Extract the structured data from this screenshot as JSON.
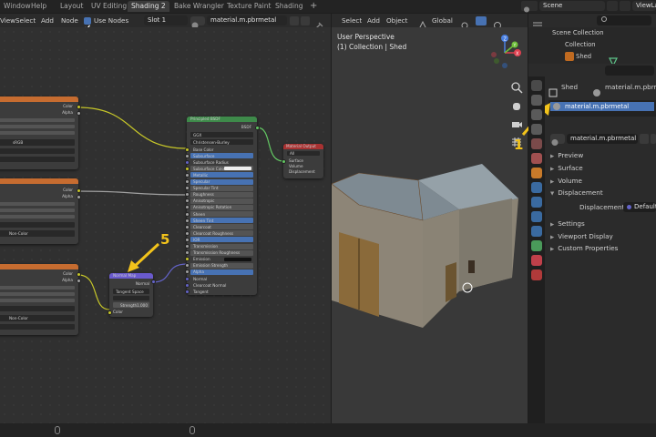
{
  "topbar": {
    "menus": [
      "Window",
      "Help"
    ],
    "tabs": [
      "Layout",
      "UV Editing",
      "Shading 2",
      "Bake Wrangler",
      "Texture Paint",
      "Shading"
    ],
    "add_tab": "+",
    "scene": "Scene",
    "view_layer": "ViewLayer"
  },
  "node_header": {
    "menus": [
      "View",
      "Select",
      "Add",
      "Node"
    ],
    "use_nodes": "Use Nodes",
    "slot": "Slot 1",
    "material": "material.m.pbrmetal"
  },
  "viewport_header": {
    "menus": [
      "Select",
      "Add",
      "Object"
    ],
    "transform": "Global"
  },
  "viewport": {
    "title": "User Perspective",
    "subtitle": "(1) Collection | Shed",
    "axis_x": "X",
    "axis_y": "Y",
    "axis_z": "Z"
  },
  "outliner": {
    "scene_collection": "Scene Collection",
    "collection": "Collection",
    "object": "Shed"
  },
  "properties": {
    "object": "Shed",
    "material": "material.m.pbrmetal",
    "slot_name": "material.m.pbrmetal",
    "mat_field": "material.m.pbrmetal",
    "sections": [
      "Preview",
      "Surface",
      "Volume",
      "Displacement"
    ],
    "displacement_label": "Displacement",
    "displacement_value": "Default",
    "sections2": [
      "Settings",
      "Viewport Display",
      "Custom Properties"
    ]
  },
  "nodes": {
    "tex1": {
      "out1": "Color",
      "out2": "Alpha",
      "field1": "sRGB"
    },
    "tex2": {
      "out1": "Color",
      "out2": "Alpha",
      "field1": "Non-Color"
    },
    "tex3": {
      "out1": "Color",
      "out2": "Alpha",
      "field1": "Non-Color"
    },
    "bsdf": {
      "title": "Principled BSDF",
      "out": "BSDF",
      "dist": "GGX",
      "ss": "Christensen-Burley",
      "inputs": [
        "Base Color",
        "Subsurface",
        "Subsurface Radius",
        "Subsurface Color",
        "Metallic",
        "Specular",
        "Specular Tint",
        "Roughness",
        "Anisotropic",
        "Anisotropic Rotation",
        "Sheen",
        "Sheen Tint",
        "Clearcoat",
        "Clearcoat Roughness",
        "IOR",
        "Transmission",
        "Transmission Roughness",
        "Emission",
        "Emission Strength",
        "Alpha",
        "Normal",
        "Clearcoat Normal",
        "Tangent"
      ]
    },
    "matout": {
      "title": "Material Output",
      "target": "All",
      "inputs": [
        "Surface",
        "Volume",
        "Displacement"
      ]
    },
    "normalmap": {
      "title": "Normal Map",
      "out": "Normal",
      "space": "Tangent Space",
      "strength_label": "Strength",
      "strength_value": "1.000",
      "color": "Color"
    }
  },
  "annotations": {
    "one": "1",
    "five": "5"
  },
  "colors": {
    "accent": "#4772b3",
    "annotation": "#f2c31b",
    "bsdf_header": "#3e8a4a",
    "output_header": "#a83232",
    "texture_header": "#c66c30",
    "normal_header": "#6a5acd"
  }
}
